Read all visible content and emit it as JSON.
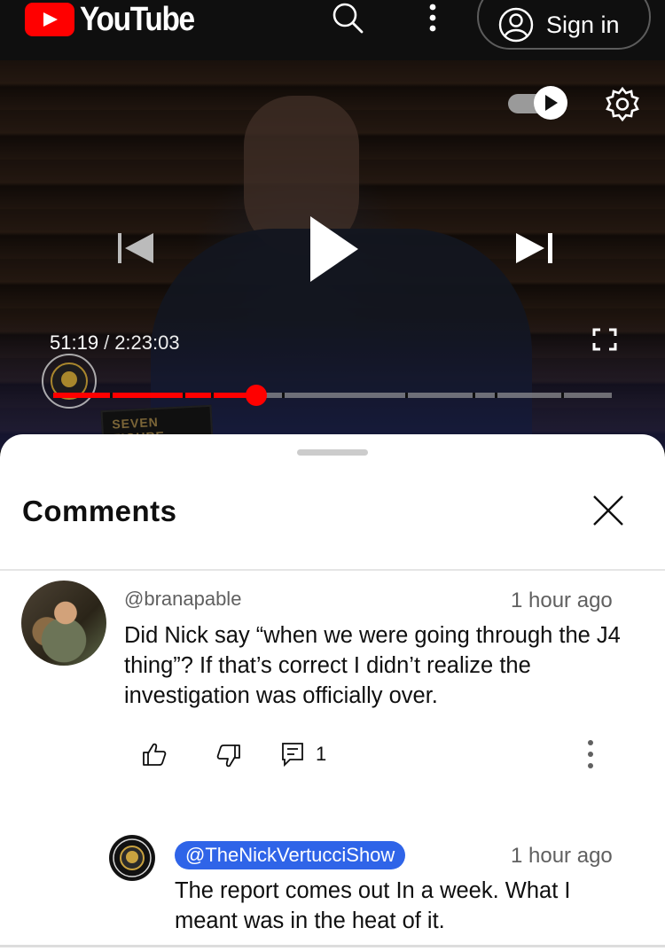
{
  "topbar": {
    "logo_text": "YouTube",
    "icons": [
      "youtube-logo-icon",
      "search-icon",
      "more-vert-icon",
      "account-icon"
    ],
    "sign_in_label": "Sign in"
  },
  "player": {
    "current_time": "51:19",
    "separator": "/",
    "duration": "2:23:03",
    "progress_fraction": 0.364,
    "autoplay_on": true,
    "book_text": "SEVEN FIGURE",
    "icons": [
      "autoplay-toggle-icon",
      "settings-gear-icon",
      "skip-previous-icon",
      "play-icon",
      "skip-next-icon",
      "fullscreen-icon"
    ],
    "colors": {
      "progress": "#ff0000"
    }
  },
  "comments": {
    "title": "Comments",
    "items": [
      {
        "handle": "@branapable",
        "time": "1 hour ago",
        "text": "Did Nick say “when we were going through the J4 thing”?  If that’s correct I didn’t realize the investigation was officially over.",
        "reply_count": "1"
      }
    ],
    "reply": {
      "handle": "@TheNickVertucciShow",
      "time": "1 hour ago",
      "text": "The report comes out In a week. What I meant was in the heat of it.",
      "handle_badge_color": "#2f64e8"
    }
  }
}
